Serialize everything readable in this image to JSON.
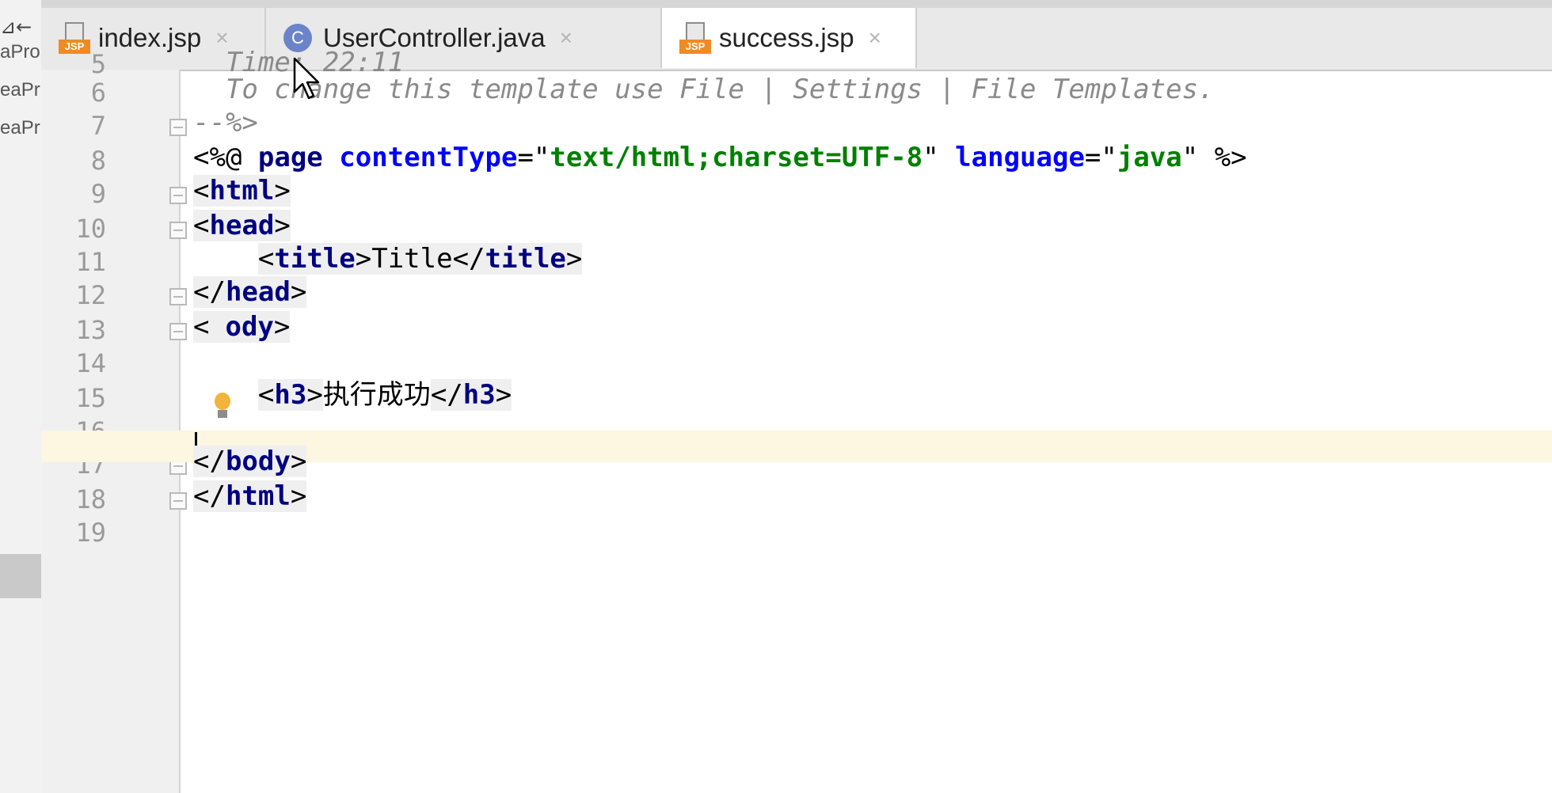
{
  "left_panel": {
    "top_glyph": "⊿←",
    "items": [
      "aPro",
      "eaPr",
      "eaPr"
    ]
  },
  "tabs": [
    {
      "label": "index.jsp",
      "icon": "jsp-file-icon",
      "icon_text": "JSP",
      "active": false
    },
    {
      "label": "UserController.java",
      "icon": "java-class-icon",
      "icon_text": "C",
      "active": false
    },
    {
      "label": "success.jsp",
      "icon": "jsp-file-icon",
      "icon_text": "JSP",
      "active": true
    }
  ],
  "tab_close_glyph": "×",
  "line_numbers": [
    "5",
    "6",
    "7",
    "8",
    "9",
    "10",
    "11",
    "12",
    "13",
    "14",
    "15",
    "16",
    "17",
    "18",
    "19"
  ],
  "code": {
    "l5": "  Time: 22:11",
    "l6": "  To change this template use File | Settings | File Templates.",
    "l7": "--%>",
    "l8": {
      "open": "<%@ ",
      "page": "page",
      "content_attr": "contentType",
      "eq": "=\"",
      "content_val": "text/html;charset=UTF-8",
      "close_q": "\" ",
      "lang_attr": "language",
      "lang_eq": "=\"",
      "lang_val": "java",
      "end": "\" %>"
    },
    "l9": {
      "lt": "<",
      "name": "html",
      "gt": ">"
    },
    "l10": {
      "lt": "<",
      "name": "head",
      "gt": ">"
    },
    "l11": {
      "indent": "    ",
      "open_lt": "<",
      "open_name": "title",
      "open_gt": ">",
      "text": "Title",
      "close_lt": "</",
      "close_name": "title",
      "close_gt": ">"
    },
    "l12": {
      "lt": "</",
      "name": "head",
      "gt": ">"
    },
    "l13": {
      "lt": "<",
      "name": "ody",
      "gt": ">"
    },
    "l15": {
      "indent": "    ",
      "open_lt": "<",
      "open_name": "h3",
      "open_gt": ">",
      "text": "执行成功",
      "close_lt": "</",
      "close_name": "h3",
      "close_gt": ">"
    },
    "l17": {
      "lt": "</",
      "name": "body",
      "gt": ">"
    },
    "l18": {
      "lt": "</",
      "name": "html",
      "gt": ">"
    }
  },
  "colors": {
    "tag": "#000080",
    "attribute": "#0000ff",
    "string": "#008000",
    "comment": "#8a8a8a",
    "current_line": "#fdf6e0",
    "jsp_icon": "#f08a24",
    "class_icon": "#6b84c9"
  }
}
